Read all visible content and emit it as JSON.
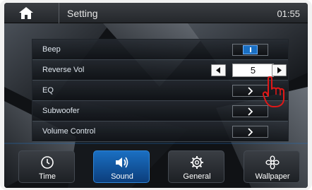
{
  "header": {
    "title": "Setting",
    "clock": "01:55"
  },
  "settings": {
    "beep": {
      "label": "Beep",
      "toggle_state": "on"
    },
    "reverse_vol": {
      "label": "Reverse Vol",
      "value": "5"
    },
    "eq": {
      "label": "EQ"
    },
    "subwoofer": {
      "label": "Subwoofer"
    },
    "volume_control": {
      "label": "Volume Control"
    }
  },
  "tabs": [
    {
      "label": "Time",
      "icon": "clock-icon",
      "active": false
    },
    {
      "label": "Sound",
      "icon": "speaker-icon",
      "active": true
    },
    {
      "label": "General",
      "icon": "gear-icon",
      "active": false
    },
    {
      "label": "Wallpaper",
      "icon": "flower-icon",
      "active": false
    }
  ],
  "colors": {
    "active_tab": "#1a6fc2",
    "annotation": "#e01818"
  }
}
